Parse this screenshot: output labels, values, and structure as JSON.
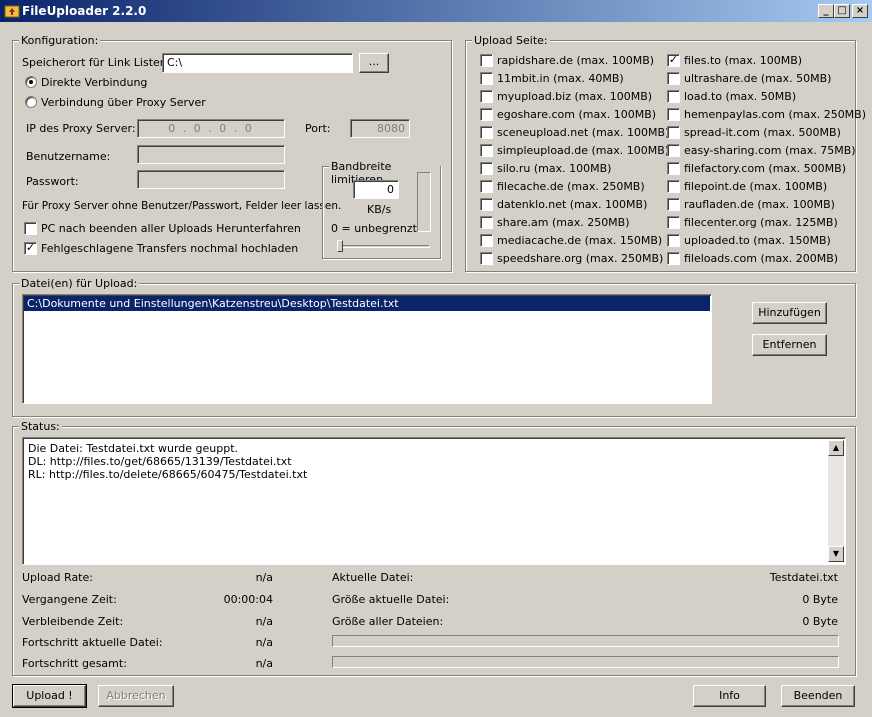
{
  "window": {
    "title": "FileUploader 2.2.0",
    "min": "_",
    "max": "□",
    "close": "×"
  },
  "config": {
    "title": "Konfiguration:",
    "path_label": "Speicherort für Link Listen:",
    "path_value": "C:\\",
    "browse_label": "...",
    "direct_label": "Direkte Verbindung",
    "proxy_label": "Verbindung über Proxy Server",
    "proxy_ip_label": "IP des Proxy Server:",
    "proxy_ip_value": "0 . 0 . 0 . 0",
    "port_label": "Port:",
    "port_value": "8080",
    "user_label": "Benutzername:",
    "pass_label": "Passwort:",
    "proxy_hint": "Für Proxy Server ohne Benutzer/Passwort, Felder leer lassen.",
    "shutdown_label": "PC nach beenden aller Uploads Herunterfahren",
    "retry_label": "Fehlgeschlagene Transfers nochmal hochladen",
    "retry_checked": true,
    "shutdown_checked": false
  },
  "bandwidth": {
    "title": "Bandbreite limitieren",
    "value": "0",
    "unit": "KB/s",
    "hint": "0 = unbegrenzt"
  },
  "upload_sites": {
    "title": "Upload Seite:",
    "left": [
      {
        "label": "rapidshare.de (max. 100MB)",
        "checked": false
      },
      {
        "label": "11mbit.in (max. 40MB)",
        "checked": false
      },
      {
        "label": "myupload.biz (max. 100MB)",
        "checked": false
      },
      {
        "label": "egoshare.com (max. 100MB)",
        "checked": false
      },
      {
        "label": "sceneupload.net (max. 100MB)",
        "checked": false
      },
      {
        "label": "simpleupload.de (max. 100MB)",
        "checked": false
      },
      {
        "label": "silo.ru (max. 100MB)",
        "checked": false
      },
      {
        "label": "filecache.de (max. 250MB)",
        "checked": false
      },
      {
        "label": "datenklo.net (max. 100MB)",
        "checked": false
      },
      {
        "label": "share.am (max. 250MB)",
        "checked": false
      },
      {
        "label": "mediacache.de (max. 150MB)",
        "checked": false
      },
      {
        "label": "speedshare.org (max. 250MB)",
        "checked": false
      }
    ],
    "right": [
      {
        "label": "files.to (max. 100MB)",
        "checked": true
      },
      {
        "label": "ultrashare.de (max. 50MB)",
        "checked": false
      },
      {
        "label": "load.to (max. 50MB)",
        "checked": false
      },
      {
        "label": "hemenpaylas.com (max. 250MB)",
        "checked": false
      },
      {
        "label": "spread-it.com (max. 500MB)",
        "checked": false
      },
      {
        "label": "easy-sharing.com (max. 75MB)",
        "checked": false
      },
      {
        "label": "filefactory.com (max. 500MB)",
        "checked": false
      },
      {
        "label": "filepoint.de (max. 100MB)",
        "checked": false
      },
      {
        "label": "raufladen.de (max. 100MB)",
        "checked": false
      },
      {
        "label": "filecenter.org (max. 125MB)",
        "checked": false
      },
      {
        "label": "uploaded.to (max. 150MB)",
        "checked": false
      },
      {
        "label": "fileloads.com (max. 200MB)",
        "checked": false
      }
    ]
  },
  "files": {
    "title": "Datei(en) für Upload:",
    "items": [
      "C:\\Dokumente und Einstellungen\\Katzenstreu\\Desktop\\Testdatei.txt"
    ],
    "add_label": "Hinzufügen",
    "remove_label": "Entfernen"
  },
  "status": {
    "title": "Status:",
    "lines": [
      "Die Datei: Testdatei.txt wurde geuppt.",
      "DL: http://files.to/get/68665/13139/Testdatei.txt",
      "RL: http://files.to/delete/68665/60475/Testdatei.txt"
    ],
    "upload_rate_label": "Upload Rate:",
    "upload_rate_value": "n/a",
    "elapsed_label": "Vergangene Zeit:",
    "elapsed_value": "00:00:04",
    "remaining_label": "Verbleibende Zeit:",
    "remaining_value": "n/a",
    "progress_file_label": "Fortschritt aktuelle Datei:",
    "progress_file_value": "n/a",
    "progress_total_label": "Fortschritt gesamt:",
    "progress_total_value": "n/a",
    "current_file_label": "Aktuelle Datei:",
    "current_file_value": "Testdatei.txt",
    "current_size_label": "Größe aktuelle Datei:",
    "current_size_value": "0 Byte",
    "total_size_label": "Größe aller Dateien:",
    "total_size_value": "0 Byte",
    "progress_file_fraction": 0,
    "progress_total_fraction": 0
  },
  "footer": {
    "upload_label": "Upload !",
    "cancel_label": "Abbrechen",
    "info_label": "Info",
    "exit_label": "Beenden"
  }
}
